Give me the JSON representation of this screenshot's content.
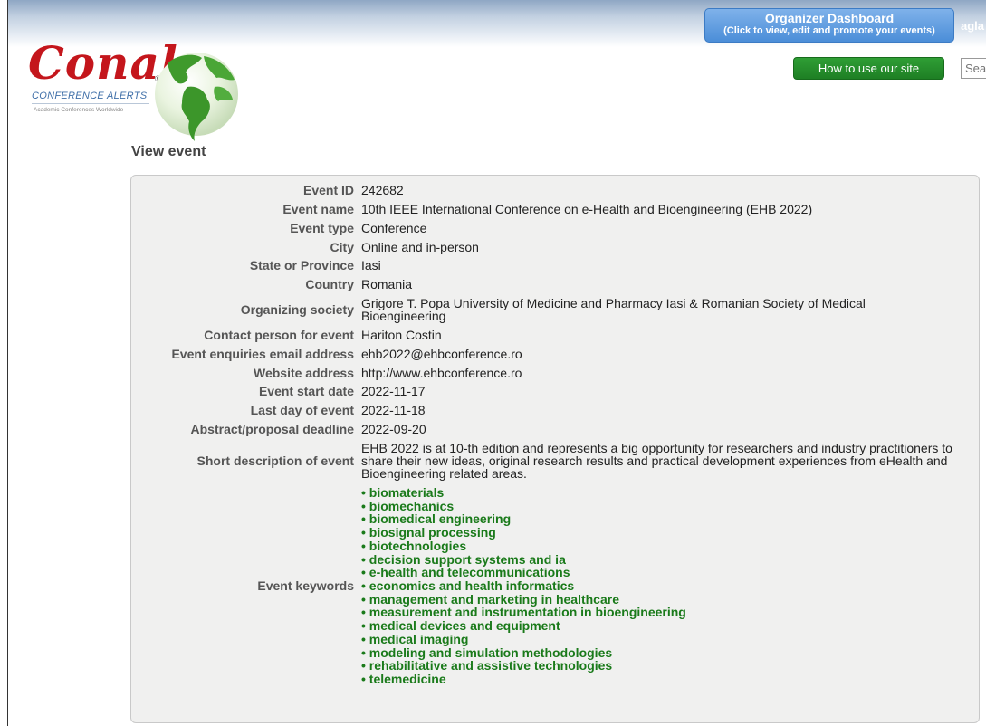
{
  "header": {
    "organizer_title": "Organizer Dashboard",
    "organizer_sub": "(Click to view, edit and promote your events)",
    "user": "agla",
    "howto_label": "How to use our site",
    "search_placeholder": "Sea"
  },
  "logo": {
    "brand": "Conal",
    "registered": "®",
    "tagline": "CONFERENCE ALERTS",
    "subtagline": "Academic Conferences Worldwide"
  },
  "page_title": "View event",
  "event": {
    "id_label": "Event ID",
    "id": "242682",
    "name_label": "Event name",
    "name": "10th IEEE International Conference on e-Health and Bioengineering (EHB 2022)",
    "type_label": "Event type",
    "type": "Conference",
    "city_label": "City",
    "city": "Online and in-person",
    "state_label": "State or Province",
    "state": "Iasi",
    "country_label": "Country",
    "country": "Romania",
    "society_label": "Organizing society",
    "society": "Grigore T. Popa University of Medicine and Pharmacy Iasi & Romanian Society of Medical Bioengineering",
    "contact_label": "Contact person for event",
    "contact": "Hariton Costin",
    "email_label": "Event enquiries email address",
    "email": "ehb2022@ehbconference.ro",
    "website_label": "Website address",
    "website": "http://www.ehbconference.ro",
    "start_label": "Event start date",
    "start": "2022-11-17",
    "last_label": "Last day of event",
    "last": "2022-11-18",
    "deadline_label": "Abstract/proposal deadline",
    "deadline": "2022-09-20",
    "desc_label": "Short description of event",
    "desc": "EHB 2022 is at 10-th edition and represents a big opportunity for researchers and industry practitioners to share their new ideas, original research results and practical development experiences from eHealth and Bioengineering related areas.",
    "keywords_label": "Event keywords",
    "keywords": [
      "• biomaterials",
      "• biomechanics",
      "• biomedical engineering",
      "• biosignal processing",
      "• biotechnologies",
      "• decision support systems and ia",
      "• e-health and telecommunications",
      "• economics and health informatics",
      "• management and marketing in healthcare",
      "• measurement and instrumentation in bioengineering",
      "• medical devices and equipment",
      "• medical imaging",
      "• modeling and simulation methodologies",
      "• rehabilitative and assistive technologies",
      "• telemedicine"
    ]
  },
  "colors": {
    "brand_red": "#c4161c",
    "organizer_blue": "#4b8ed8",
    "howto_green": "#1e7f24",
    "keyword_green": "#1a7a1a"
  }
}
